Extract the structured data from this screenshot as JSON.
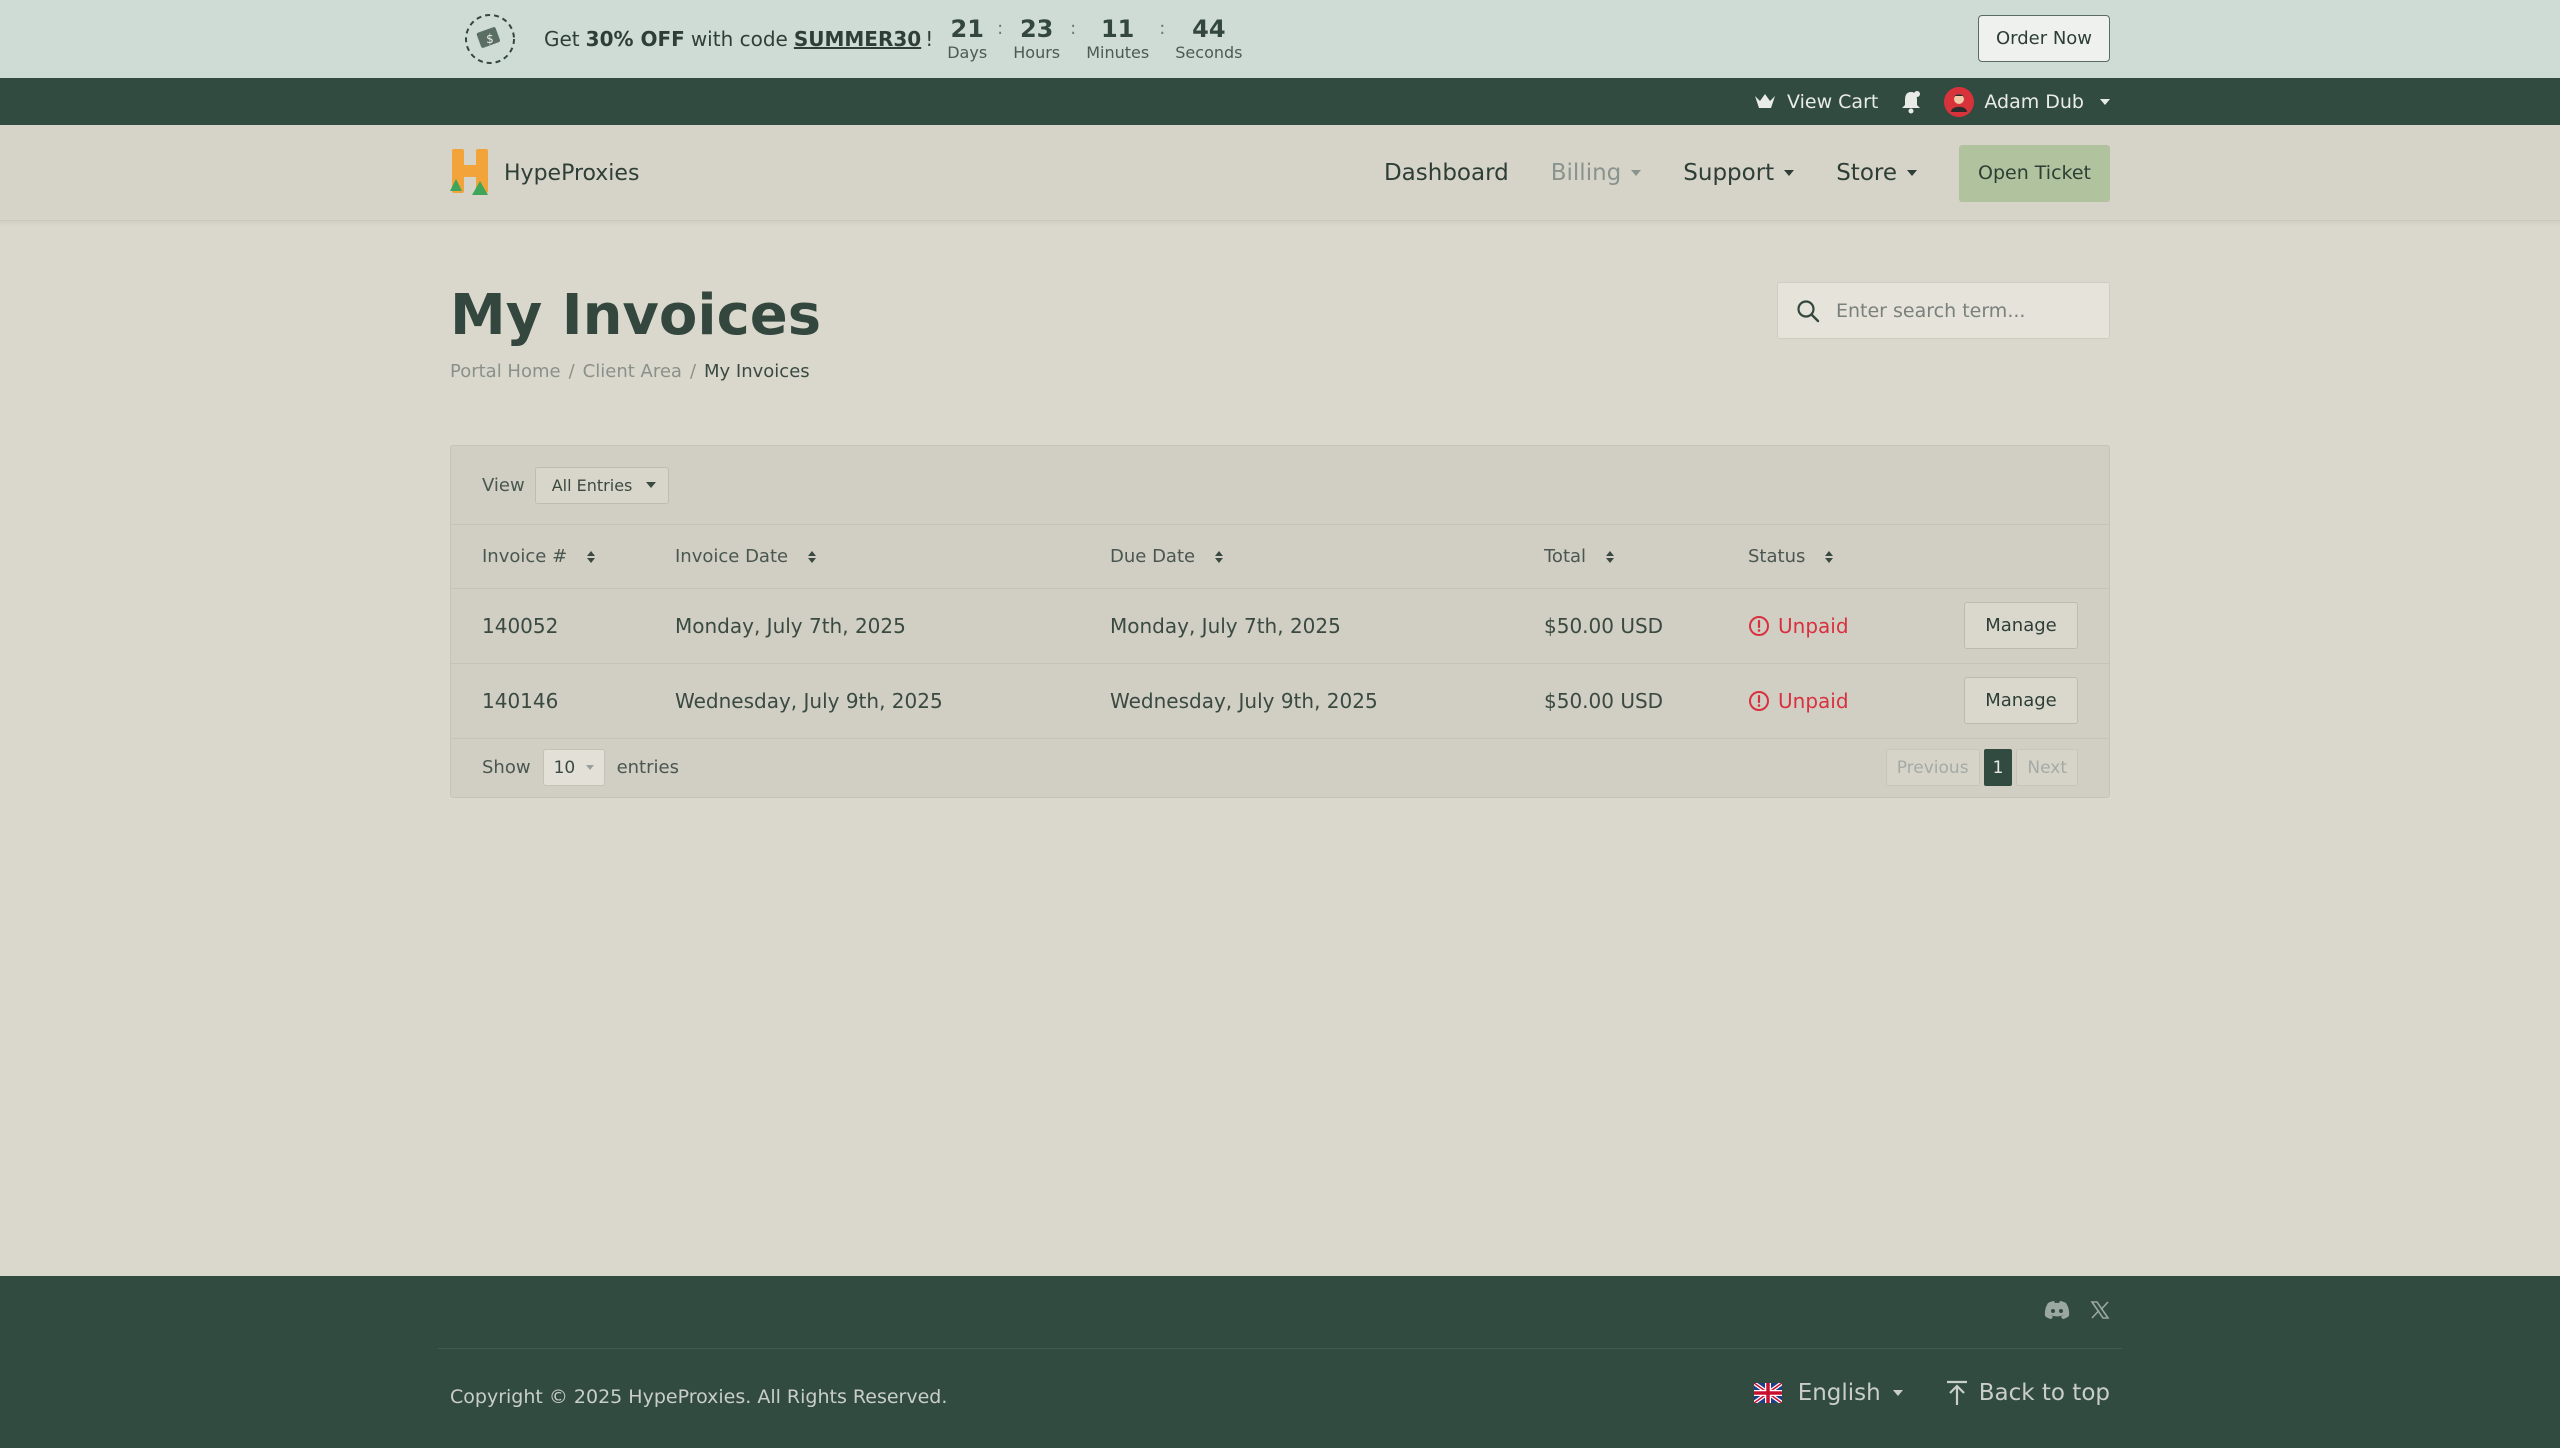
{
  "promo": {
    "text_prefix": "Get",
    "discount": "30% OFF",
    "text_mid": "with code",
    "code": "SUMMER30",
    "text_suffix": "!",
    "countdown": [
      {
        "value": "21",
        "label": "Days"
      },
      {
        "value": "23",
        "label": "Hours"
      },
      {
        "value": "11",
        "label": "Minutes"
      },
      {
        "value": "44",
        "label": "Seconds"
      }
    ],
    "separator": ":",
    "order_button": "Order Now"
  },
  "topbar": {
    "cart_label": "View Cart",
    "user_name": "Adam Dub"
  },
  "navbar": {
    "brand": "HypeProxies",
    "links": {
      "dashboard": "Dashboard",
      "billing": "Billing",
      "support": "Support",
      "store": "Store"
    },
    "open_ticket": "Open Ticket"
  },
  "page": {
    "title": "My Invoices",
    "breadcrumb": [
      "Portal Home",
      "Client Area",
      "My Invoices"
    ],
    "breadcrumb_sep": "/",
    "search_placeholder": "Enter search term..."
  },
  "table": {
    "view_label": "View",
    "view_value": "All Entries",
    "columns": [
      "Invoice #",
      "Invoice Date",
      "Due Date",
      "Total",
      "Status"
    ],
    "rows": [
      {
        "invoice": "140052",
        "date": "Monday, July 7th, 2025",
        "due": "Monday, July 7th, 2025",
        "total": "$50.00 USD",
        "status": "Unpaid",
        "action": "Manage"
      },
      {
        "invoice": "140146",
        "date": "Wednesday, July 9th, 2025",
        "due": "Wednesday, July 9th, 2025",
        "total": "$50.00 USD",
        "status": "Unpaid",
        "action": "Manage"
      }
    ],
    "show_label": "Show",
    "length_value": "10",
    "entries_label": "entries",
    "pager": {
      "previous": "Previous",
      "current": "1",
      "next": "Next"
    }
  },
  "footer": {
    "copyright": "Copyright © 2025 HypeProxies. All Rights Reserved.",
    "language": "English",
    "back_to_top": "Back to top"
  },
  "colors": {
    "accent_dark": "#324b40",
    "accent_light": "#b0c29e",
    "danger": "#d9303f",
    "background": "#dad8cc"
  },
  "icons": [
    "discount-timer-icon",
    "cart-icon",
    "bell-icon",
    "avatar",
    "brand-logo",
    "search-icon",
    "sort-icon",
    "alert-circle-icon",
    "discord-icon",
    "x-icon",
    "uk-flag-icon",
    "back-to-top-icon"
  ]
}
